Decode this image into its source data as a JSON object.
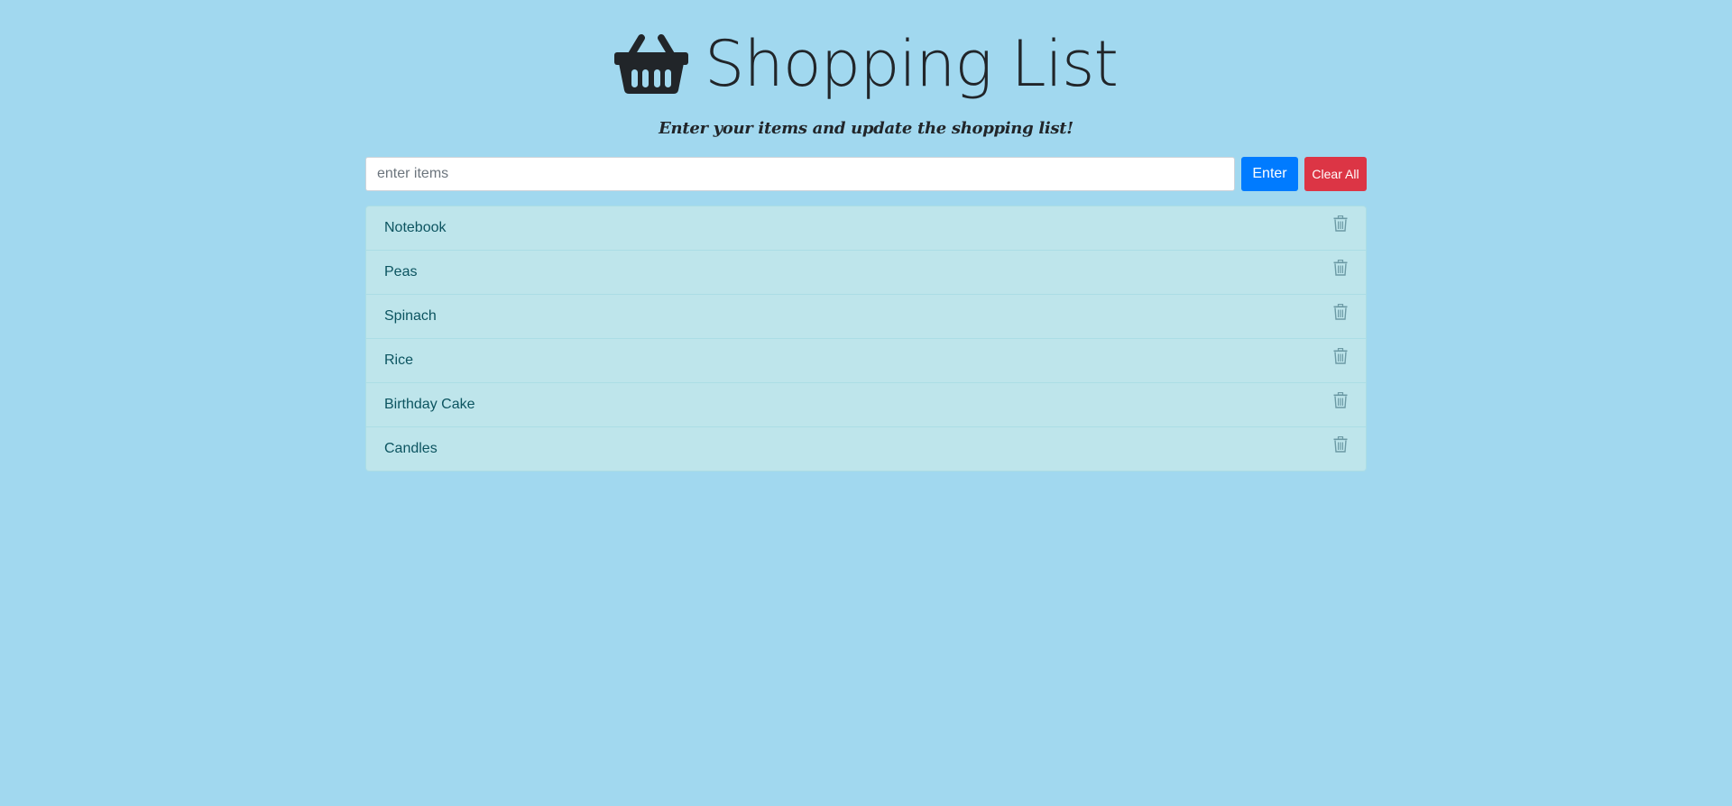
{
  "header": {
    "title": "Shopping List",
    "icon": "basket-icon",
    "subtitle": "Enter your items and update the shopping list!"
  },
  "entry": {
    "placeholder": "enter items",
    "value": "",
    "enter_label": "Enter",
    "clear_label": "Clear All"
  },
  "items": [
    {
      "label": "Notebook",
      "icon": "trash-icon"
    },
    {
      "label": "Peas",
      "icon": "trash-icon"
    },
    {
      "label": "Spinach",
      "icon": "trash-icon"
    },
    {
      "label": "Rice",
      "icon": "trash-icon"
    },
    {
      "label": "Birthday Cake",
      "icon": "trash-icon"
    },
    {
      "label": "Candles",
      "icon": "trash-icon"
    }
  ],
  "colors": {
    "background": "#a1d8ef",
    "enter_button": "#007bff",
    "clear_button": "#dc3545",
    "list_item_bg": "#bee5eb",
    "list_item_text": "#0c5460",
    "title_text": "#212529"
  }
}
